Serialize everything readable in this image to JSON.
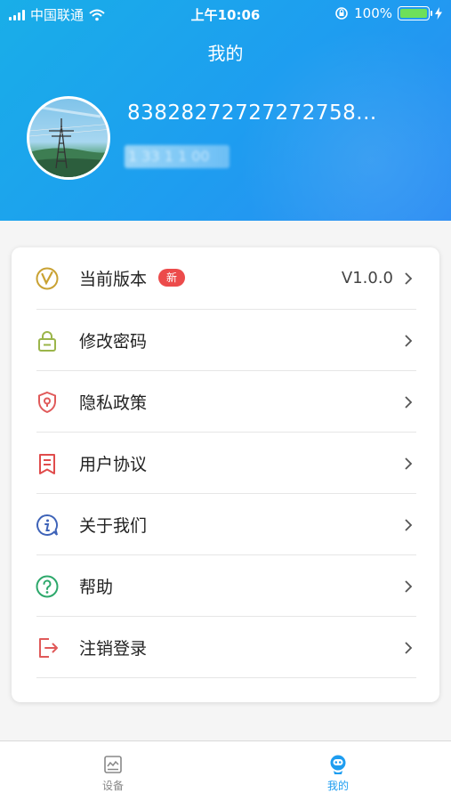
{
  "status_bar": {
    "carrier": "中国联通",
    "time": "上午10:06",
    "battery": "100%"
  },
  "header": {
    "title": "我的",
    "user_id": "83828272727272758...",
    "user_sub_obscured": "1 33 1 1 00"
  },
  "menu": [
    {
      "label": "当前版本",
      "icon": "version-v-icon",
      "badge": "新",
      "value": "V1.0.0",
      "color": "#c9a233"
    },
    {
      "label": "修改密码",
      "icon": "lock-icon",
      "color": "#9bb54a"
    },
    {
      "label": "隐私政策",
      "icon": "shield-icon",
      "color": "#e05a5a"
    },
    {
      "label": "用户协议",
      "icon": "document-icon",
      "color": "#e04c4c"
    },
    {
      "label": "关于我们",
      "icon": "info-icon",
      "color": "#3e63b8"
    },
    {
      "label": "帮助",
      "icon": "help-icon",
      "color": "#2da86b"
    },
    {
      "label": "注销登录",
      "icon": "logout-icon",
      "color": "#e05a5a"
    }
  ],
  "tabbar": {
    "items": [
      {
        "label": "设备",
        "icon": "device-monitor-icon",
        "active": false
      },
      {
        "label": "我的",
        "icon": "profile-robot-icon",
        "active": true
      }
    ]
  },
  "colors": {
    "accent": "#1e9df0",
    "badge": "#ec4b4b"
  }
}
